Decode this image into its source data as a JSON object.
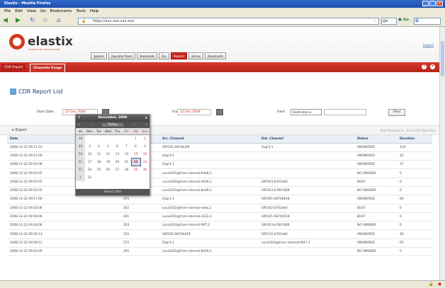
{
  "browser": {
    "title": "Elastix - Mozilla Firefox",
    "menu": [
      "File",
      "Edit",
      "View",
      "Go",
      "Bookmarks",
      "Tools",
      "Help"
    ],
    "url": "https://xxx.xxx.xxx.xxx",
    "search_label": "G",
    "go_label": "Go"
  },
  "app": {
    "logo_text": "elastix",
    "logo_tagline": "freedom to communicate",
    "tabs": [
      "System",
      "Operator Panel",
      "Voicemails",
      "Fax",
      "Reports",
      "Extras",
      "Downloads"
    ],
    "active_tab": "Reports",
    "logout": "Logout",
    "subtabs": [
      "CDR Report",
      "Channels Usage"
    ],
    "active_subtab": "Channels Usage"
  },
  "report": {
    "title": "CDR Report List",
    "start_label": "Start Date:",
    "start_value": "22 Dec 2008",
    "end_label": "End Date:",
    "end_value": "22 Dec 2008",
    "field_label": "Field:",
    "field_value": "Destination",
    "filter_button": "Filter",
    "export": "Export",
    "pager": "Start  Previous (1 - 20 of 202) Next  End",
    "columns": [
      "Date",
      "Source",
      "Destination",
      "Src. Channel",
      "Dst. Channel",
      "Status",
      "Duration"
    ],
    "rows": [
      [
        "2008-12-22 09:11:10",
        "",
        "",
        "SIP/201-0878a2f8",
        "Zap/1-1",
        "ANSWERED",
        "219"
      ],
      [
        "2008-12-22 09:15:00",
        "",
        "",
        "Zap/3-1",
        "",
        "ANSWERED",
        "22"
      ],
      [
        "2008-12-22 09:16:08",
        "",
        "",
        "Zap/3-1",
        "",
        "ANSWERED",
        "37"
      ],
      [
        "2008-12-22 09:16:55",
        "",
        "",
        "Local/201@from-internal-0eb6,2",
        "",
        "NO ANSWER",
        "0"
      ],
      [
        "2008-12-22 09:16:55",
        "",
        "",
        "Local/202@from-internal-2006,2",
        "SIP/203-b761eb0",
        "BUSY",
        "0"
      ],
      [
        "2008-12-22 09:16:55",
        "",
        "",
        "Local/203@from-internal-bed0,2",
        "SIP/203-b7801468",
        "NO ANSWER",
        "0"
      ],
      [
        "2008-12-22 09:17:00",
        "",
        "203",
        "Zap/3-1",
        "SIP/201-0874b618",
        "ANSWERED",
        "84"
      ],
      [
        "2008-12-22 09:18:06",
        "",
        "202",
        "Local/202@from-internal-eeba,2",
        "SIP/202-b761eb0",
        "BUSY",
        "0"
      ],
      [
        "2008-12-22 09:18:06",
        "",
        "201",
        "Local/201@from-internal-1022,2",
        "SIP/201-0874b518",
        "BUSY",
        "0"
      ],
      [
        "2008-12-22 09:18:06",
        "",
        "203",
        "Local/203@from-internal-f0f7,2",
        "SIP/203-b7801468",
        "NO ANSWER",
        "0"
      ],
      [
        "2008-12-22 09:18:13",
        "",
        "215",
        "SIP/202-0874b618",
        "SIP/215-b761eb0",
        "ANSWERED",
        "40"
      ],
      [
        "2008-12-22 09:18:51",
        "",
        "215",
        "Zap/3-1",
        "Local/203@from-internal-f047,1",
        "ANSWERED",
        "65"
      ],
      [
        "2008-12-22 09:20:09",
        "",
        "201",
        "Local/201@from-internal-6e29,2",
        "",
        "NO ANSWER",
        "0"
      ]
    ]
  },
  "calendar": {
    "title": "December, 2008",
    "nav_prev_year": "«",
    "nav_prev": "‹",
    "nav_today": "Today",
    "nav_next": "›",
    "nav_next_year": "»",
    "help": "?",
    "close": "x",
    "weekday_header": [
      "wk",
      "Mon",
      "Tue",
      "Wed",
      "Thu",
      "Fri",
      "Sat",
      "Sun"
    ],
    "weeks": [
      [
        "48",
        "",
        "",
        "",
        "",
        "",
        "1",
        "2"
      ],
      [
        "49",
        "3",
        "4",
        "5",
        "6",
        "7",
        "8",
        "9"
      ],
      [
        "50",
        "10",
        "11",
        "12",
        "13",
        "14",
        "15",
        "16"
      ],
      [
        "51",
        "17",
        "18",
        "19",
        "20",
        "21",
        "22",
        "23"
      ],
      [
        "52",
        "24",
        "25",
        "26",
        "27",
        "28",
        "29",
        "30"
      ],
      [
        "1",
        "31",
        "",
        "",
        "",
        "",
        "",
        ""
      ]
    ],
    "selected_day": "22",
    "footer": "Select date"
  },
  "colors": {
    "brand_red": "#c92c1e",
    "title_blue": "#1e3d6b"
  }
}
